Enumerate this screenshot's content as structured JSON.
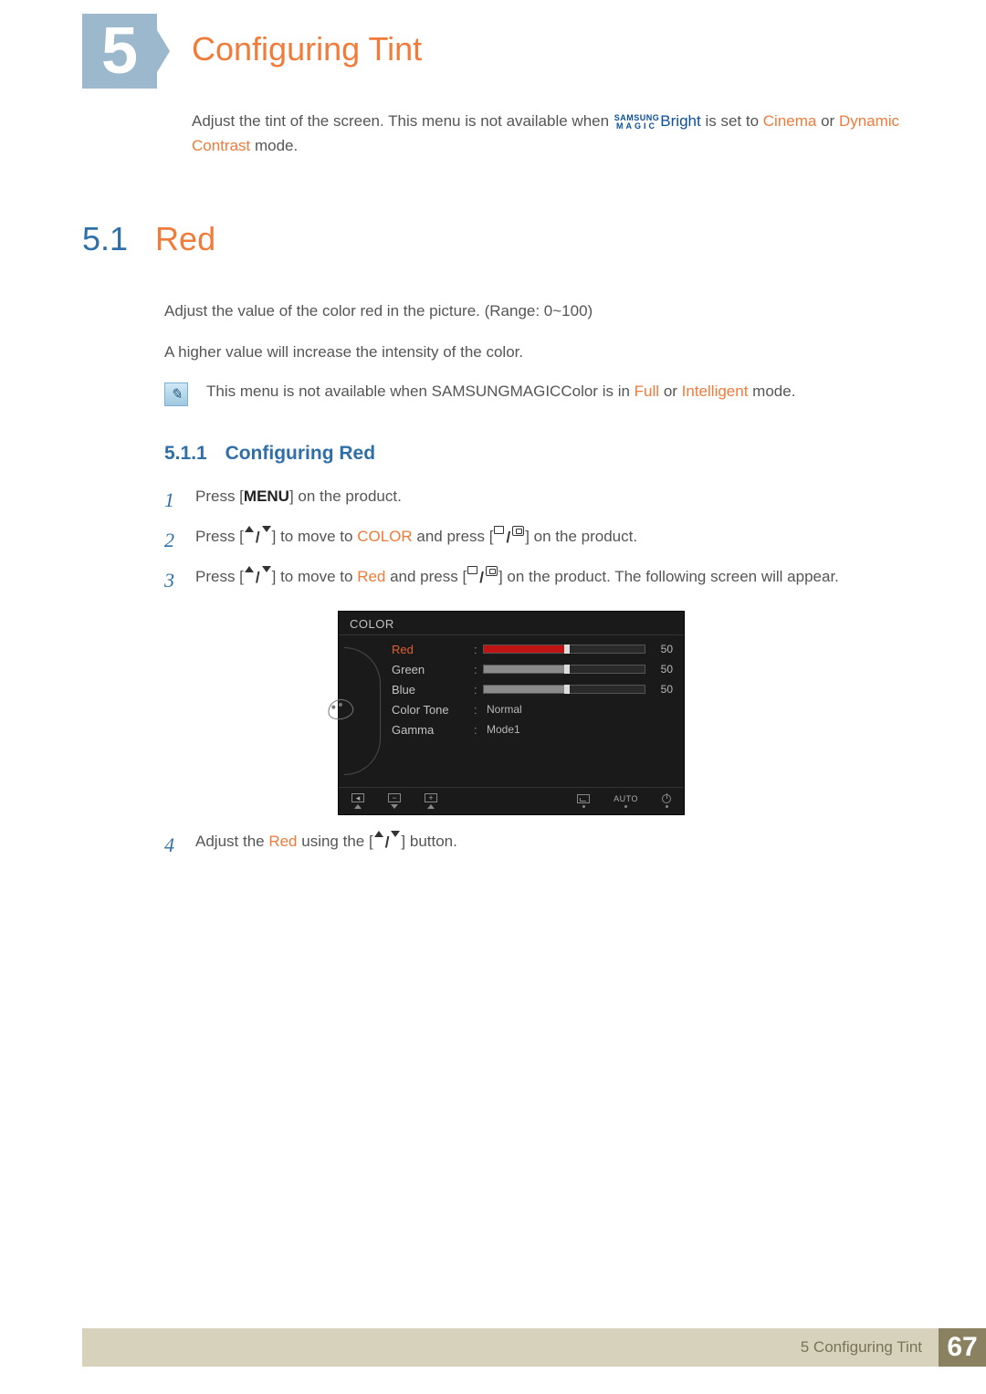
{
  "chapter": {
    "num": "5",
    "title": "Configuring Tint"
  },
  "intro": {
    "pre": "Adjust the tint of the screen. This menu is not available when ",
    "magic_bright_l1": "SAMSUNG",
    "magic_bright_l2": "MAGIC",
    "bright_word": "Bright",
    "mid": " is set to ",
    "cinema": "Cinema",
    "or": " or ",
    "dc": "Dynamic Contrast",
    "end": " mode."
  },
  "section": {
    "num": "5.1",
    "title": "Red"
  },
  "body": {
    "p1": "Adjust the value of the color red in the picture. (Range: 0~100)",
    "p2": "A higher value will increase the intensity of the color."
  },
  "note": {
    "pre": "This menu is not available when ",
    "magic_l1": "SAMSUNG",
    "magic_l2": "MAGIC",
    "color_word": "Color",
    "mid": " is in ",
    "full": "Full",
    "or": " or ",
    "intelligent": "Intelligent",
    "end": " mode."
  },
  "subhead": {
    "num": "5.1.1",
    "title": "Configuring Red"
  },
  "steps": {
    "s1_a": "Press [",
    "s1_menu": "MENU",
    "s1_b": "] on the product.",
    "s2_a": "Press [",
    "s2_b": "] to move to ",
    "s2_color": "COLOR",
    "s2_c": " and press [",
    "s2_d": "] on the product.",
    "s3_a": "Press [",
    "s3_b": "] to move to ",
    "s3_red": "Red",
    "s3_c": " and press [",
    "s3_d": "] on the product. The following screen will appear.",
    "s4_a": "Adjust the ",
    "s4_red": "Red",
    "s4_b": " using the [",
    "s4_c": "] button."
  },
  "osd": {
    "title": "COLOR",
    "rows": {
      "red": {
        "label": "Red",
        "value": "50"
      },
      "green": {
        "label": "Green",
        "value": "50"
      },
      "blue": {
        "label": "Blue",
        "value": "50"
      },
      "tone": {
        "label": "Color Tone",
        "text": "Normal"
      },
      "gamma": {
        "label": "Gamma",
        "text": "Mode1"
      }
    },
    "auto": "AUTO"
  },
  "footer": {
    "label": "5 Configuring Tint",
    "page": "67"
  }
}
